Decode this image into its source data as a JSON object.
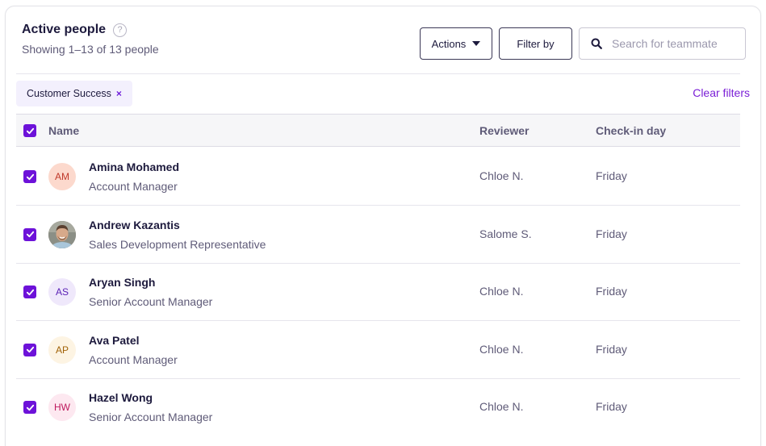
{
  "header": {
    "title": "Active people",
    "help_icon": "?",
    "subtitle": "Showing 1–13 of 13 people"
  },
  "toolbar": {
    "actions_label": "Actions",
    "filter_label": "Filter by",
    "search_placeholder": "Search for teammate",
    "search_value": ""
  },
  "filters": {
    "chips": [
      {
        "label": "Customer Success",
        "remove": "×"
      }
    ],
    "clear_label": "Clear filters"
  },
  "table": {
    "columns": [
      "Name",
      "Reviewer",
      "Check-in day"
    ],
    "select_all_checked": true,
    "rows": [
      {
        "checked": true,
        "initials": "AM",
        "avatar_bg": "#fcd9cd",
        "avatar_fg": "#c0392b",
        "name": "Amina Mohamed",
        "role": "Account Manager",
        "reviewer": "Chloe N.",
        "day": "Friday",
        "photo": false
      },
      {
        "checked": true,
        "initials": "",
        "avatar_bg": "#7a6a5a",
        "avatar_fg": "#ffffff",
        "name": "Andrew Kazantis",
        "role": "Sales Development Representative",
        "reviewer": "Salome S.",
        "day": "Friday",
        "photo": true
      },
      {
        "checked": true,
        "initials": "AS",
        "avatar_bg": "#efe8fb",
        "avatar_fg": "#5b21b6",
        "name": "Aryan Singh",
        "role": "Senior Account Manager",
        "reviewer": "Chloe N.",
        "day": "Friday",
        "photo": false
      },
      {
        "checked": true,
        "initials": "AP",
        "avatar_bg": "#fdf4e3",
        "avatar_fg": "#a16207",
        "name": "Ava Patel",
        "role": "Account Manager",
        "reviewer": "Chloe N.",
        "day": "Friday",
        "photo": false
      },
      {
        "checked": true,
        "initials": "HW",
        "avatar_bg": "#fde8f0",
        "avatar_fg": "#be185d",
        "name": "Hazel Wong",
        "role": "Senior Account Manager",
        "reviewer": "Chloe N.",
        "day": "Friday",
        "photo": false
      }
    ]
  },
  "colors": {
    "accent": "#6d12d9",
    "link": "#7b1fd6",
    "chip_bg": "#f3f0fd"
  }
}
